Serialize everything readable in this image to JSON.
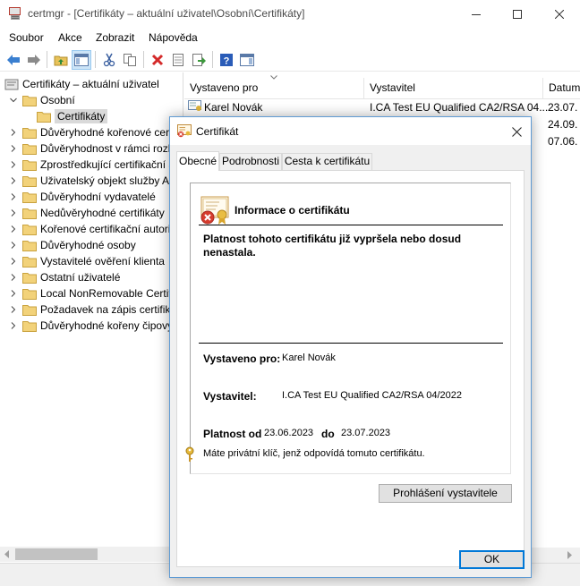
{
  "window": {
    "title": "certmgr - [Certifikáty – aktuální uživatel\\Osobní\\Certifikáty]"
  },
  "menu": [
    "Soubor",
    "Akce",
    "Zobrazit",
    "Nápověda"
  ],
  "tree": {
    "root": "Certifikáty – aktuální uživatel",
    "personal": "Osobní",
    "certificates": "Certifikáty",
    "items": [
      "Důvěryhodné kořenové certifikační autority",
      "Důvěryhodnost v rámci rozlehlé sítě",
      "Zprostředkující certifikační autority",
      "Uživatelský objekt služby Active Directory",
      "Důvěryhodní vydavatelé",
      "Nedůvěryhodné certifikáty",
      "Kořenové certifikační autority třetích stran",
      "Důvěryhodné osoby",
      "Vystavitelé ověření klienta",
      "Ostatní uživatelé",
      "Local NonRemovable Certificates",
      "Požadavek na zápis certifikátu",
      "Důvěryhodné kořeny čipových karet"
    ]
  },
  "list": {
    "columns": [
      "Vystaveno pro",
      "Vystavitel",
      "Datum"
    ],
    "rows": [
      {
        "issued_to": "Karel Novák",
        "issuer": "I.CA Test EU Qualified CA2/RSA 04...",
        "date": "23.07."
      },
      {
        "issued_to": "",
        "issuer": "",
        "date": "24.09."
      },
      {
        "issued_to": "",
        "issuer": "",
        "date": "07.06."
      }
    ]
  },
  "dialog": {
    "title": "Certifikát",
    "close_icon": "close-icon",
    "tabs": [
      "Obecné",
      "Podrobnosti",
      "Cesta k certifikátu"
    ],
    "active_tab": 0,
    "info_title": "Informace o certifikátu",
    "warning": "Platnost tohoto certifikátu již vypršela nebo dosud nenastala.",
    "issued_to_label": "Vystaveno pro:",
    "issued_to_value": "Karel Novák",
    "issuer_label": "Vystavitel:",
    "issuer_value": "I.CA Test EU Qualified CA2/RSA 04/2022",
    "validity_from_label": "Platnost od",
    "validity_from": "23.06.2023",
    "validity_to_label": "do",
    "validity_to": "23.07.2023",
    "private_key_note": "Máte privátní klíč, jenž odpovídá tomuto certifikátu.",
    "issuer_statement_button": "Prohlášení vystavitele",
    "ok_button": "OK"
  },
  "colors": {
    "accent": "#0078d7",
    "dialog_border": "#5f9bd4",
    "folder": "#e8c25a",
    "selected_tree": "#d9d9d9"
  }
}
